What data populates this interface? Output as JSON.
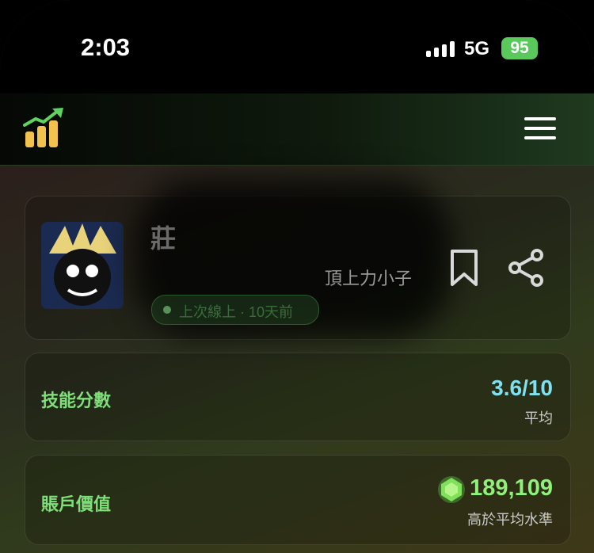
{
  "status_bar": {
    "time": "2:03",
    "network": "5G",
    "battery": "95"
  },
  "header": {
    "logo_icon": "bar-chart-growth-icon",
    "menu_icon": "hamburger-menu-icon"
  },
  "profile": {
    "name_visible": "莊",
    "tag_visible": "頂上力小子",
    "pill_text": "上次線上 · 10天前",
    "bookmark_icon": "bookmark-icon",
    "share_icon": "share-icon"
  },
  "skill": {
    "label": "技能分數",
    "score": "3.6/10",
    "note": "平均"
  },
  "account": {
    "label": "賬戶價值",
    "value": "189,109",
    "note": "高於平均水準",
    "gem_icon": "green-gem-icon"
  },
  "colors": {
    "accent_green": "#7fe07a",
    "score_cyan": "#7fe0f0",
    "value_green": "#8ff07a",
    "battery_green": "#59c95b"
  }
}
